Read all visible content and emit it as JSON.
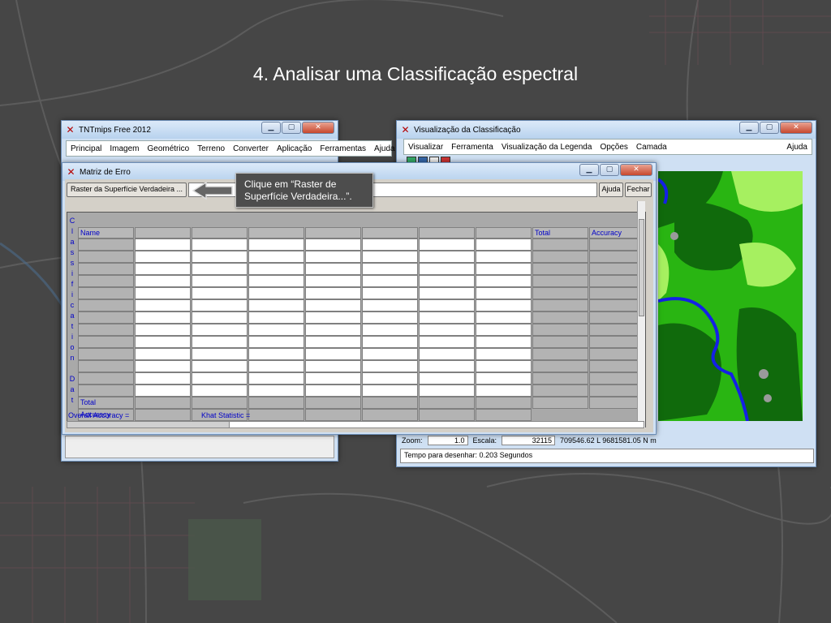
{
  "slide": {
    "title": "4. Analisar uma Classificação espectral"
  },
  "colors": {
    "accent_blue": "#0000c8",
    "map_green": "#29b512",
    "river_blue": "#1420e6"
  },
  "tntmips": {
    "title": "TNTmips Free 2012",
    "menu": [
      "Principal",
      "Imagem",
      "Geométrico",
      "Terreno",
      "Converter",
      "Aplicação",
      "Ferramentas",
      "Ajuda"
    ]
  },
  "viewer": {
    "title": "Visualização da Classificação",
    "menu": [
      "Visualizar",
      "Ferramenta",
      "Visualização da Legenda",
      "Opções",
      "Camada"
    ],
    "help": "Ajuda",
    "zoom_label": "Zoom:",
    "zoom_value": "1.0",
    "scale_label": "Escala:",
    "scale_value": "32115",
    "coords": "709546.62 L  9681581.05 N m",
    "status": "Tempo para desenhar: 0.203 Segundos"
  },
  "matrix": {
    "title": "Matriz de Erro",
    "raster_button": "Raster da Superfície Verdadeira ...",
    "help_button": "Ajuda",
    "close_button": "Fechar",
    "row_axis_label": [
      "C",
      "l",
      "a",
      "s",
      "s",
      "i",
      "f",
      "i",
      "c",
      "a",
      "t",
      "i",
      "o",
      "n",
      "",
      "D",
      "a",
      "t"
    ],
    "col_name": "Name",
    "col_total": "Total",
    "col_accuracy": "Accuracy",
    "row_total": "Total",
    "row_accuracy": "Accuracy",
    "overall_accuracy": "Overall Accuracy =",
    "khat": "Khat Statistic ="
  },
  "callout": {
    "text": "Clique em “Raster de Superfície Verdadeira...”."
  },
  "icons": [
    "close-icon",
    "minimize-icon",
    "maximize-icon",
    "arrow-left-icon",
    "toolbar-icons"
  ]
}
